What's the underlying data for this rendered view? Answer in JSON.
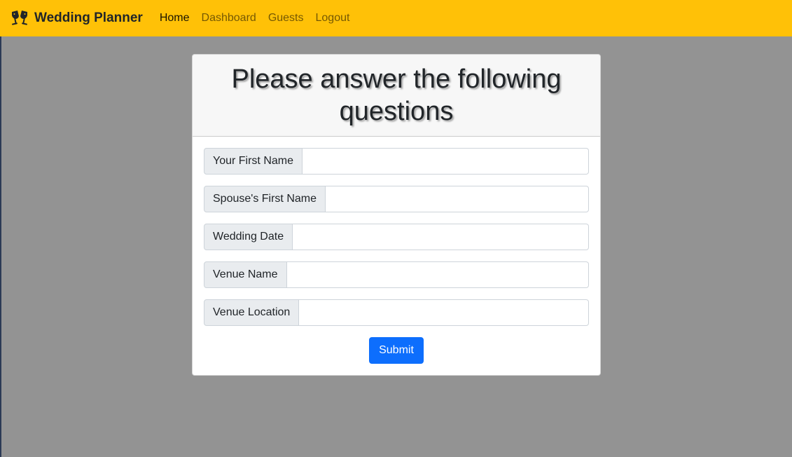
{
  "navbar": {
    "brand_icon": "wedding-glasses-icon",
    "brand_label": "Wedding Planner",
    "links": [
      {
        "label": "Home",
        "active": true
      },
      {
        "label": "Dashboard",
        "active": false
      },
      {
        "label": "Guests",
        "active": false
      },
      {
        "label": "Logout",
        "active": false
      }
    ]
  },
  "form": {
    "title": "Please answer the following questions",
    "fields": [
      {
        "label": "Your First Name",
        "value": ""
      },
      {
        "label": "Spouse's First Name",
        "value": ""
      },
      {
        "label": "Wedding Date",
        "value": ""
      },
      {
        "label": "Venue Name",
        "value": ""
      },
      {
        "label": "Venue Location",
        "value": ""
      }
    ],
    "submit_label": "Submit"
  },
  "colors": {
    "navbar_bg": "#ffc107",
    "page_bg": "#939393",
    "primary_button": "#0d6efd"
  }
}
